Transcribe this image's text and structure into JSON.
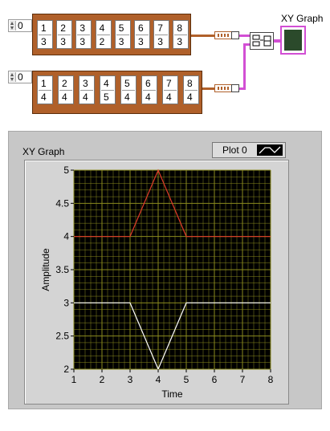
{
  "block_diagram": {
    "graph_terminal_label": "XY Graph",
    "arrays": [
      {
        "index": "0",
        "cluster_rows": [
          [
            "1",
            "2",
            "3",
            "4",
            "5",
            "6",
            "7",
            "8"
          ],
          [
            "3",
            "3",
            "3",
            "2",
            "3",
            "3",
            "3",
            "3"
          ]
        ]
      },
      {
        "index": "0",
        "cluster_rows": [
          [
            "1",
            "2",
            "3",
            "4",
            "5",
            "6",
            "7",
            "8"
          ],
          [
            "4",
            "4",
            "4",
            "5",
            "4",
            "4",
            "4",
            "4"
          ]
        ]
      }
    ]
  },
  "front_panel": {
    "graph_title": "XY Graph",
    "legend_label": "Plot 0",
    "xlabel": "Time",
    "ylabel": "Amplitude",
    "x_ticks": [
      "1",
      "2",
      "3",
      "4",
      "5",
      "6",
      "7",
      "8"
    ],
    "y_ticks": [
      "2",
      "2.5",
      "3",
      "3.5",
      "4",
      "4.5",
      "5"
    ],
    "colors": {
      "plot_bg": "#000000",
      "grid": "#8a8a1e",
      "series_1": "#ffffff",
      "series_2": "#e03a2a"
    }
  },
  "chart_data": {
    "type": "line",
    "title": "XY Graph",
    "xlabel": "Time",
    "ylabel": "Amplitude",
    "xlim": [
      1,
      8
    ],
    "ylim": [
      2,
      5
    ],
    "series": [
      {
        "x": [
          1,
          2,
          3,
          4,
          5,
          6,
          7,
          8
        ],
        "y": [
          3,
          3,
          3,
          2,
          3,
          3,
          3,
          3
        ],
        "color": "#ffffff"
      },
      {
        "x": [
          1,
          2,
          3,
          4,
          5,
          6,
          7,
          8
        ],
        "y": [
          4,
          4,
          4,
          5,
          4,
          4,
          4,
          4
        ],
        "color": "#e03a2a"
      }
    ],
    "legend": [
      "Plot 0"
    ],
    "grid": true
  }
}
